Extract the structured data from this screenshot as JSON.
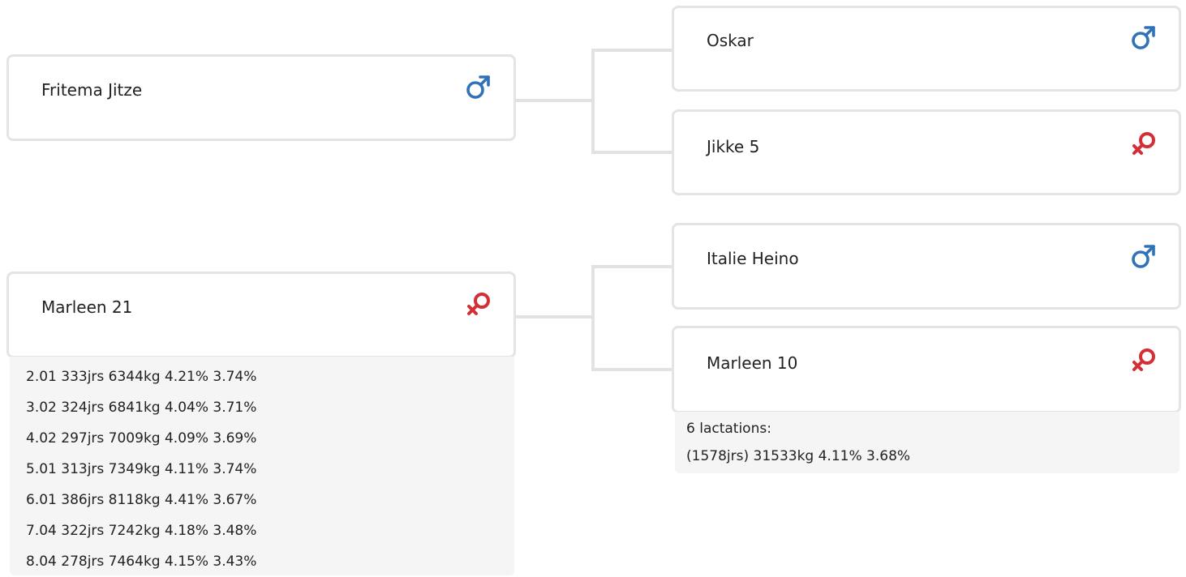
{
  "colors": {
    "male": "#2f72b8",
    "female": "#d22f37",
    "border": "#e4e4e4",
    "panel": "#f5f5f5"
  },
  "animals": {
    "sire": {
      "name": "Fritema Jitze",
      "sex_icon": "male-icon"
    },
    "dam": {
      "name": "Marleen 21",
      "sex_icon": "female-icon"
    },
    "sire_sire": {
      "name": "Oskar",
      "sex_icon": "male-icon"
    },
    "sire_dam": {
      "name": "Jikke 5",
      "sex_icon": "female-icon"
    },
    "dam_sire": {
      "name": "Italie Heino",
      "sex_icon": "male-icon"
    },
    "dam_dam": {
      "name": "Marleen 10",
      "sex_icon": "female-icon"
    }
  },
  "dam_lactations": [
    "2.01 333jrs 6344kg 4.21% 3.74%",
    "3.02 324jrs 6841kg 4.04% 3.71%",
    "4.02 297jrs 7009kg 4.09% 3.69%",
    "5.01 313jrs 7349kg 4.11% 3.74%",
    "6.01 386jrs 8118kg 4.41% 3.67%",
    "7.04 322jrs 7242kg 4.18% 3.48%",
    "8.04 278jrs 7464kg 4.15% 3.43%"
  ],
  "dam_dam_lactations": {
    "count_label": "6 lactations:",
    "summary": "(1578jrs) 31533kg 4.11% 3.68%"
  }
}
